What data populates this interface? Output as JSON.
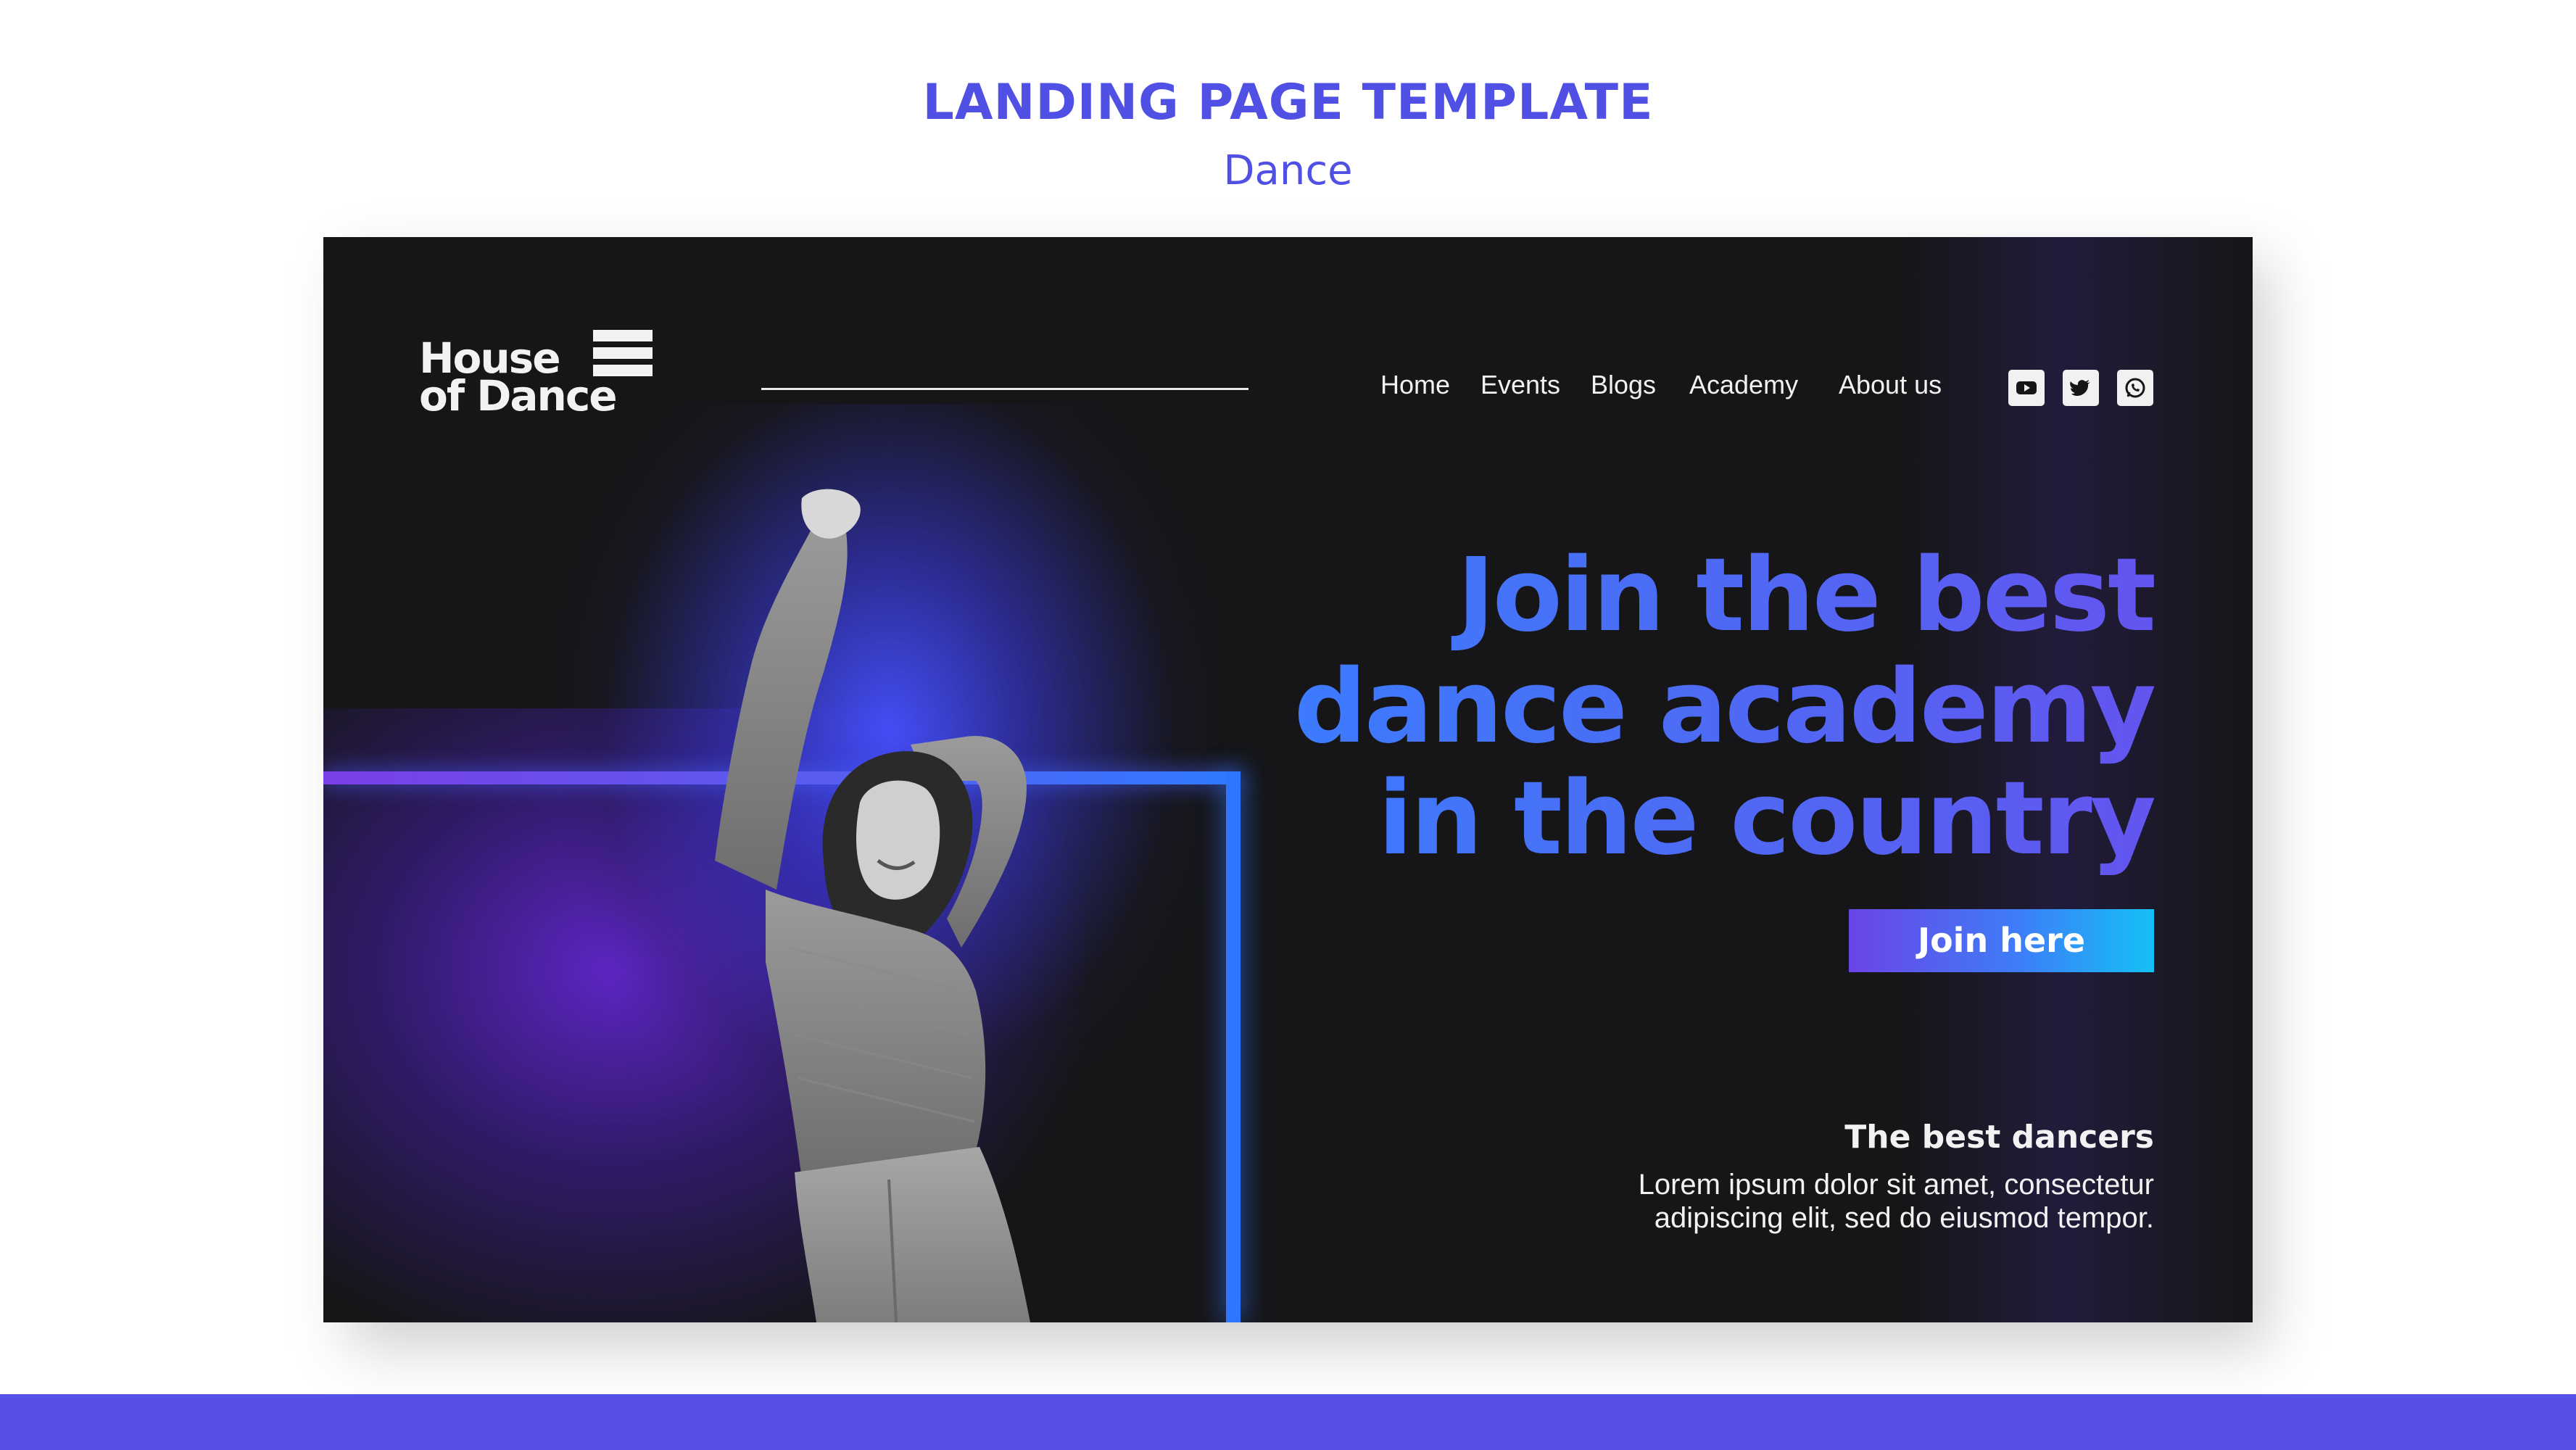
{
  "header": {
    "title": "LANDING PAGE TEMPLATE",
    "subtitle": "Dance"
  },
  "mockup": {
    "logo": {
      "line1": "House",
      "line2": "of Dance"
    },
    "nav": {
      "items": [
        {
          "label": "Home"
        },
        {
          "label": "Events"
        },
        {
          "label": "Blogs"
        },
        {
          "label": "Academy"
        },
        {
          "label": "About us"
        }
      ]
    },
    "social": [
      "youtube-icon",
      "twitter-icon",
      "whatsapp-icon"
    ],
    "hero": {
      "headline_lines": [
        "Join the best",
        "dance academy",
        "in the country"
      ],
      "cta_label": "Join here"
    },
    "info": {
      "title": "The best dancers",
      "description": "Lorem ipsum dolor sit amet, consectetur adipiscing elit, sed do eiusmod tempor."
    }
  },
  "colors": {
    "accent": "#5650e8",
    "dark_bg": "#161618",
    "neon_blue": "#2f75ff",
    "neon_purple": "#7a3fe8",
    "cta_start": "#6b44e6",
    "cta_end": "#14c1f5"
  }
}
